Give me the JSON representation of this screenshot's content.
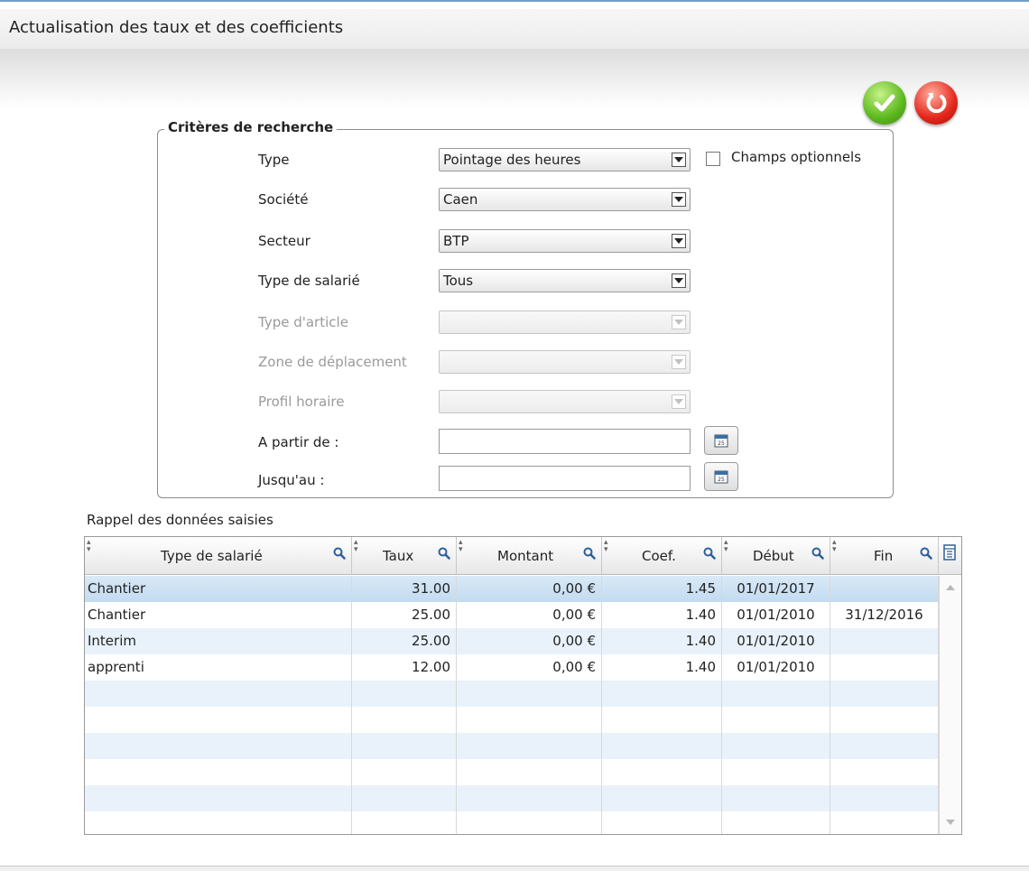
{
  "window": {
    "title": "Actualisation des taux et des coefficients"
  },
  "toolbar": {
    "validate": "validate-icon",
    "cancel": "cancel-icon"
  },
  "criteria": {
    "legend": "Critères de recherche",
    "type": {
      "label": "Type",
      "value": "Pointage des heures"
    },
    "optional": {
      "label": "Champs optionnels",
      "checked": false
    },
    "societe": {
      "label": "Société",
      "value": "Caen"
    },
    "secteur": {
      "label": "Secteur",
      "value": "BTP"
    },
    "type_salarie": {
      "label": "Type de salarié",
      "value": "Tous"
    },
    "type_article": {
      "label": "Type d'article",
      "value": ""
    },
    "zone": {
      "label": "Zone de déplacement",
      "value": ""
    },
    "profil": {
      "label": "Profil horaire",
      "value": ""
    },
    "from": {
      "label": "A partir de :",
      "value": ""
    },
    "to": {
      "label": "Jusqu'au :",
      "value": ""
    }
  },
  "grid": {
    "title": "Rappel des données saisies",
    "columns": [
      "Type de salarié",
      "Taux",
      "Montant",
      "Coef.",
      "Début",
      "Fin"
    ],
    "rows": [
      [
        "Chantier",
        "31.00",
        "0,00 €",
        "1.45",
        "01/01/2017",
        ""
      ],
      [
        "Chantier",
        "25.00",
        "0,00 €",
        "1.40",
        "01/01/2010",
        "31/12/2016"
      ],
      [
        "Interim",
        "25.00",
        "0,00 €",
        "1.40",
        "01/01/2010",
        ""
      ],
      [
        "apprenti",
        "12.00",
        "0,00 €",
        "1.40",
        "01/01/2010",
        ""
      ]
    ]
  },
  "colors": {
    "selected_row": "#c3dbf0",
    "alt_row": "#e9f2fa",
    "ok": "#5cb81d",
    "cancel": "#e4261a"
  }
}
